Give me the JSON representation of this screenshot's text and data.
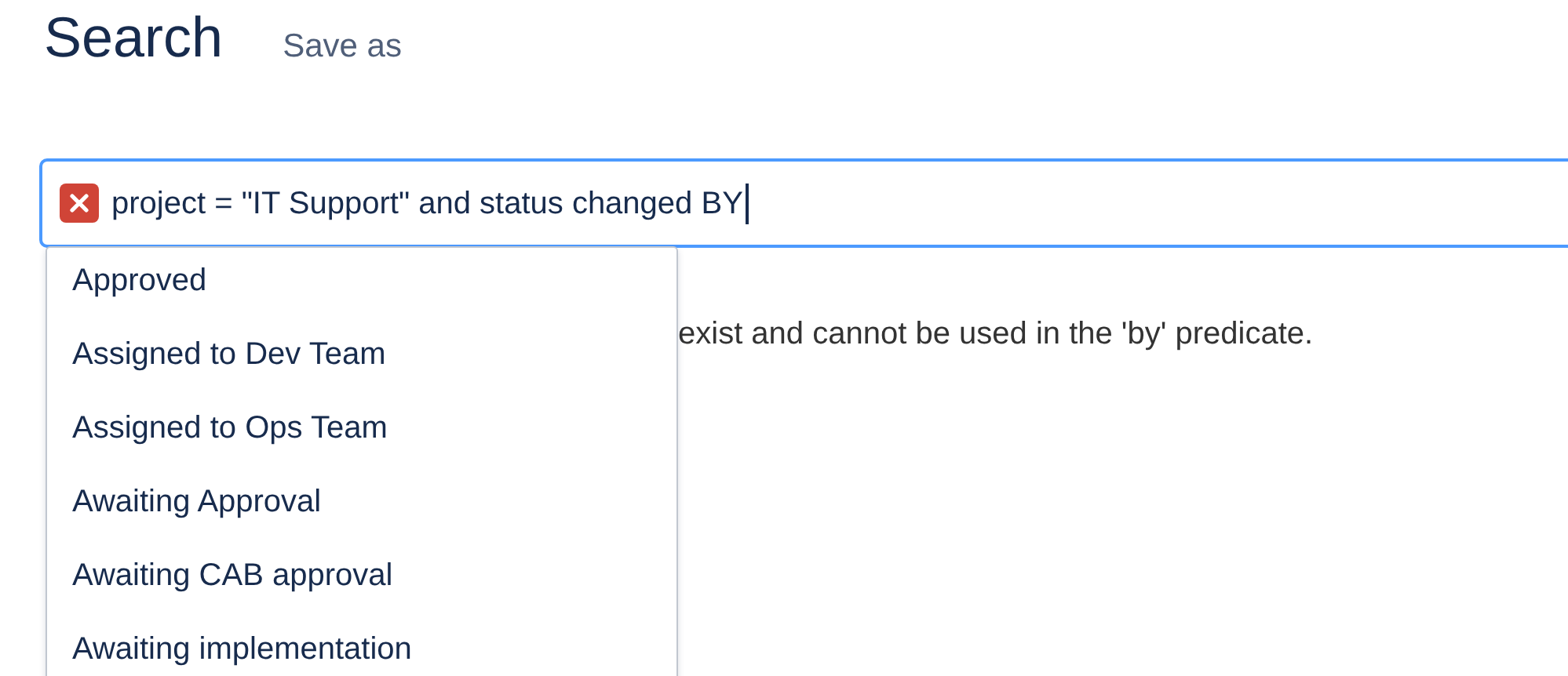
{
  "title": "Search",
  "save_as_link": "Save as",
  "query": {
    "value": "project = \"IT Support\" and status changed BY",
    "invalid": true
  },
  "error_message": "exist and cannot be used in the 'by' predicate.",
  "suggestions": [
    {
      "label": "Approved"
    },
    {
      "label": "Assigned to Dev Team"
    },
    {
      "label": "Assigned to Ops Team"
    },
    {
      "label": "Awaiting Approval"
    },
    {
      "label": "Awaiting CAB approval"
    },
    {
      "label": "Awaiting implementation"
    }
  ]
}
